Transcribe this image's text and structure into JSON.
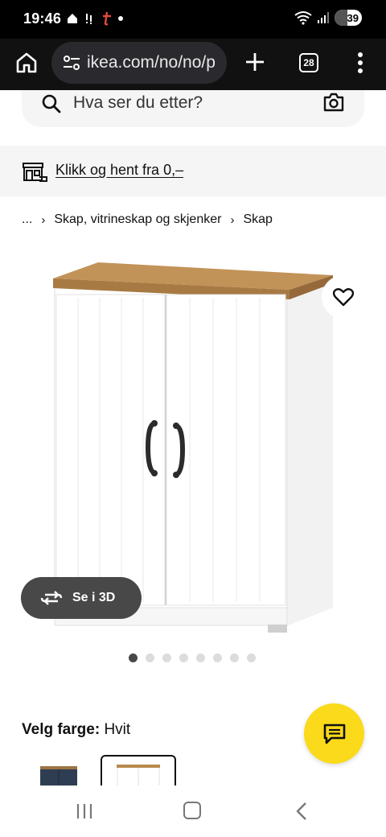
{
  "status_bar": {
    "time": "19:46",
    "battery": "39"
  },
  "browser": {
    "url": "ikea.com/no/no/p",
    "tab_count": "28"
  },
  "search": {
    "placeholder": "Hva ser du etter?"
  },
  "delivery": {
    "text": "Klikk og hent fra 0,–"
  },
  "breadcrumb": {
    "ellipsis": "...",
    "items": [
      "Skap, vitrineskap og skjenker",
      "Skap"
    ]
  },
  "product": {
    "view_3d_label": "Se i 3D",
    "image_count": 8,
    "active_image_index": 0
  },
  "color": {
    "label": "Velg farge:",
    "value": "Hvit"
  },
  "colors": {
    "accent": "#fada1a",
    "dark_button": "#484848",
    "wood": "#b88a4e"
  }
}
